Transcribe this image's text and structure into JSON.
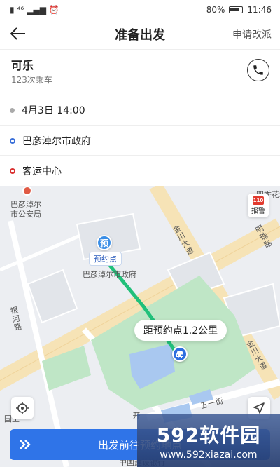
{
  "status_bar": {
    "signal": "⁴⁶",
    "battery": "80%",
    "time": "11:46"
  },
  "header": {
    "title": "准备出发",
    "reassign_label": "申请改派"
  },
  "passenger": {
    "name": "可乐",
    "ride_count": "123次乘车"
  },
  "trip": {
    "time": "4月3日 14:00",
    "pickup": "巴彦淖尔市政府",
    "dropoff": "客运中心"
  },
  "map": {
    "labels": {
      "police": "巴彦淖尔\n市公安局",
      "gov": "巴彦淖尔市政府",
      "jinchuan1": "金川大道",
      "jinchuan2": "金川大道",
      "yinhe": "银河路",
      "wuyi": "五一街",
      "mingzhu": "明珠路",
      "sijifu": "四季花城",
      "guotu": "国土",
      "kai": "开",
      "bottom": "中国建设银行"
    },
    "pickup_pin": "预",
    "pickup_pin_label": "预约点",
    "distance_text": "距预约点1.2公里",
    "alarm_badge": "110",
    "alarm_label": "报警"
  },
  "bottom": {
    "depart_label": "出发前往预约地点"
  },
  "watermark": {
    "logo": "592软件园",
    "url": "www.592xiazai.com"
  },
  "colors": {
    "accent": "#2f74e8",
    "route": "#21c07a",
    "park": "#bfe6c6",
    "water": "#a9c8f0"
  }
}
